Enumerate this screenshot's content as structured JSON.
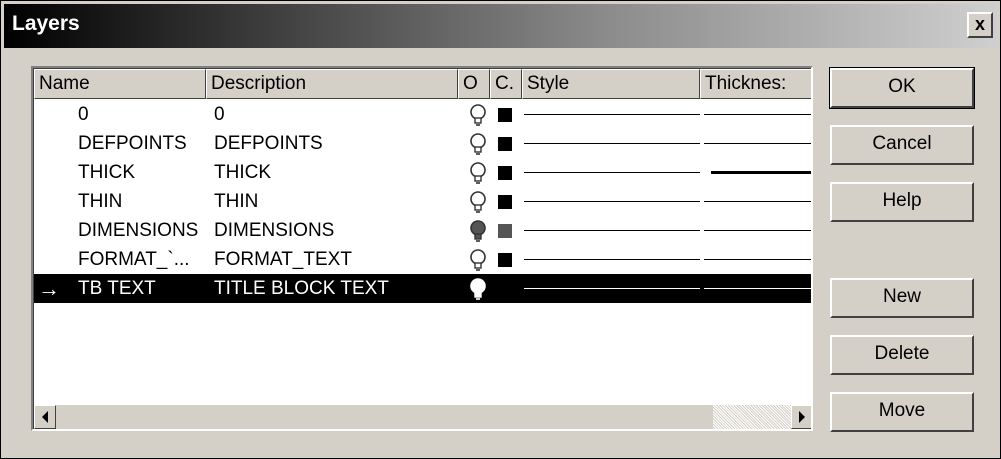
{
  "window": {
    "title": "Layers",
    "close_label": "x"
  },
  "columns": {
    "name": "Name",
    "description": "Description",
    "on": "O",
    "color": "C.",
    "style": "Style",
    "thickness": "Thicknes:"
  },
  "rows": [
    {
      "name": "0",
      "description": "0",
      "bulb": "off",
      "color": "#000000",
      "thickness": "thin",
      "selected": false
    },
    {
      "name": "DEFPOINTS",
      "description": "DEFPOINTS",
      "bulb": "off",
      "color": "#000000",
      "thickness": "thin",
      "selected": false
    },
    {
      "name": "THICK",
      "description": "THICK",
      "bulb": "off",
      "color": "#000000",
      "thickness": "thick",
      "selected": false
    },
    {
      "name": "THIN",
      "description": "THIN",
      "bulb": "off",
      "color": "#000000",
      "thickness": "thin",
      "selected": false
    },
    {
      "name": "DIMENSIONS",
      "description": "DIMENSIONS",
      "bulb": "on",
      "color": "#555555",
      "thickness": "thin",
      "selected": false
    },
    {
      "name": "FORMAT_`...",
      "description": "FORMAT_TEXT",
      "bulb": "off",
      "color": "#000000",
      "thickness": "thin",
      "selected": false
    },
    {
      "name": "TB TEXT",
      "description": "TITLE BLOCK TEXT",
      "bulb": "on",
      "color": "#000000",
      "thickness": "thin",
      "selected": true
    }
  ],
  "buttons": {
    "ok": "OK",
    "cancel": "Cancel",
    "help": "Help",
    "new": "New",
    "delete": "Delete",
    "move": "Move"
  },
  "icons": {
    "bulb": "lightbulb-icon",
    "selected_marker": "arrow-right-icon",
    "scroll_left": "scroll-left-arrow-icon",
    "scroll_right": "scroll-right-arrow-icon"
  }
}
